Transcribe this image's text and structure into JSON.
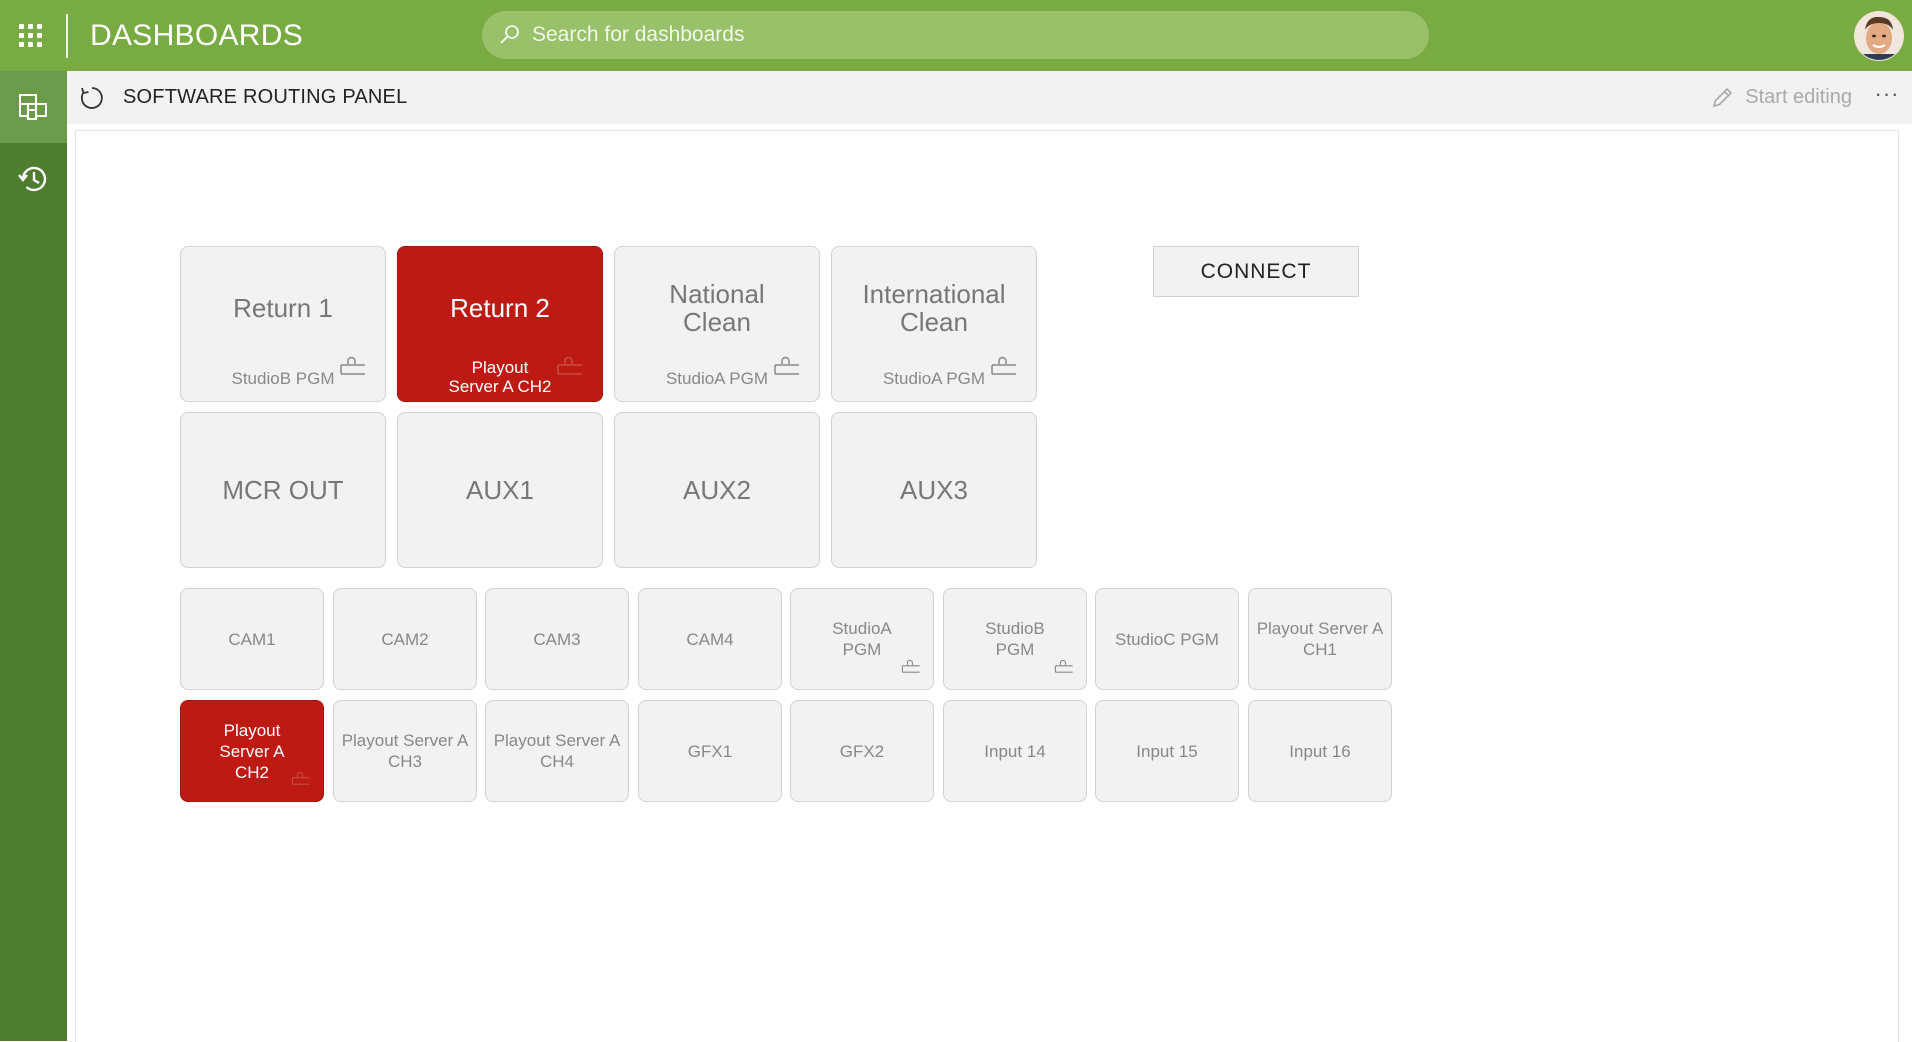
{
  "header": {
    "app_title": "DASHBOARDS",
    "search_placeholder": "Search for dashboards",
    "brand_color": "#79ab43",
    "rail_color": "#4e7d2e"
  },
  "rail": {
    "items": [
      {
        "name": "dashboards-icon",
        "active": true
      },
      {
        "name": "history-icon",
        "active": false
      }
    ]
  },
  "subheader": {
    "title": "SOFTWARE ROUTING PANEL",
    "start_editing": "Start editing",
    "more": "···"
  },
  "destinations": [
    {
      "label": "Return 1",
      "source": "StudioB PGM",
      "selected": false,
      "locked": true
    },
    {
      "label": "Return 2",
      "source": "Playout Server A CH2",
      "selected": true,
      "locked": true
    },
    {
      "label": "National Clean",
      "source": "StudioA PGM",
      "selected": false,
      "locked": true
    },
    {
      "label": "International Clean",
      "source": "StudioA PGM",
      "selected": false,
      "locked": true
    },
    {
      "label": "MCR OUT",
      "source": "",
      "selected": false,
      "locked": false
    },
    {
      "label": "AUX1",
      "source": "",
      "selected": false,
      "locked": false
    },
    {
      "label": "AUX2",
      "source": "",
      "selected": false,
      "locked": false
    },
    {
      "label": "AUX3",
      "source": "",
      "selected": false,
      "locked": false
    }
  ],
  "connect_label": "CONNECT",
  "sources": [
    {
      "label": "CAM1",
      "selected": false,
      "locked": false
    },
    {
      "label": "CAM2",
      "selected": false,
      "locked": false
    },
    {
      "label": "CAM3",
      "selected": false,
      "locked": false
    },
    {
      "label": "CAM4",
      "selected": false,
      "locked": false
    },
    {
      "label": "StudioA PGM",
      "selected": false,
      "locked": true
    },
    {
      "label": "StudioB PGM",
      "selected": false,
      "locked": true
    },
    {
      "label": "StudioC PGM",
      "selected": false,
      "locked": false
    },
    {
      "label": "Playout Server A CH1",
      "selected": false,
      "locked": false
    },
    {
      "label": "Playout Server A CH2",
      "selected": true,
      "locked": true
    },
    {
      "label": "Playout Server A CH3",
      "selected": false,
      "locked": false
    },
    {
      "label": "Playout Server A CH4",
      "selected": false,
      "locked": false
    },
    {
      "label": "GFX1",
      "selected": false,
      "locked": false
    },
    {
      "label": "GFX2",
      "selected": false,
      "locked": false
    },
    {
      "label": "Input 14",
      "selected": false,
      "locked": false
    },
    {
      "label": "Input 15",
      "selected": false,
      "locked": false
    },
    {
      "label": "Input 16",
      "selected": false,
      "locked": false
    }
  ],
  "selected_color": "#bd1a14"
}
